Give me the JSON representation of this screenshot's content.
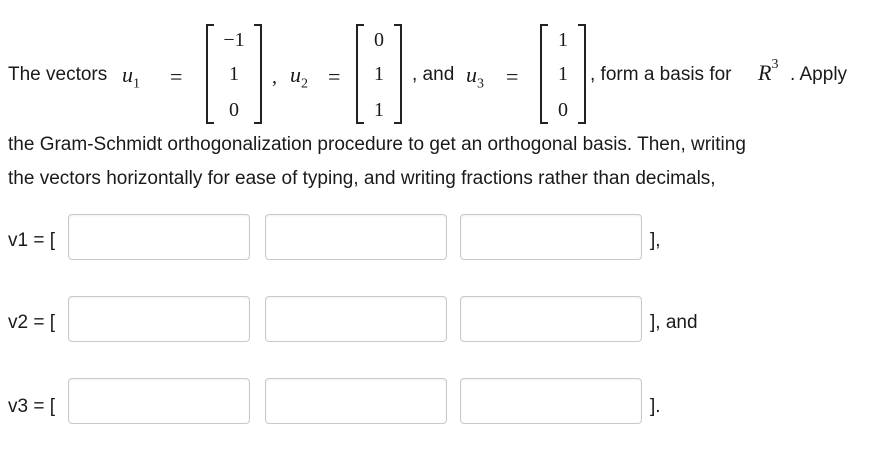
{
  "problem": {
    "intro": "The vectors",
    "u1_label": "u",
    "u1_sub": "1",
    "u2_label": "u",
    "u2_sub": "2",
    "u3_label": "u",
    "u3_sub": "3",
    "equals": "=",
    "comma": ",",
    "and_text": ", and",
    "u1": [
      "−1",
      "1",
      "0"
    ],
    "u2": [
      "0",
      "1",
      "1"
    ],
    "u3": [
      "1",
      "1",
      "0"
    ],
    "after_u3": ", form a basis for",
    "space_R": "R",
    "space_exp": "3",
    "after_space": ". Apply",
    "line2": "the Gram-Schmidt orthogonalization procedure to get an orthogonal basis. Then, writing",
    "line3": "the vectors horizontally for ease of typing, and writing fractions rather than decimals,"
  },
  "answers": [
    {
      "label": "v1 = [",
      "ending": "],",
      "values": [
        "",
        "",
        ""
      ]
    },
    {
      "label": "v2 = [",
      "ending": "], and",
      "values": [
        "",
        "",
        ""
      ]
    },
    {
      "label": "v3 = [",
      "ending": "].",
      "values": [
        "",
        "",
        ""
      ]
    }
  ]
}
